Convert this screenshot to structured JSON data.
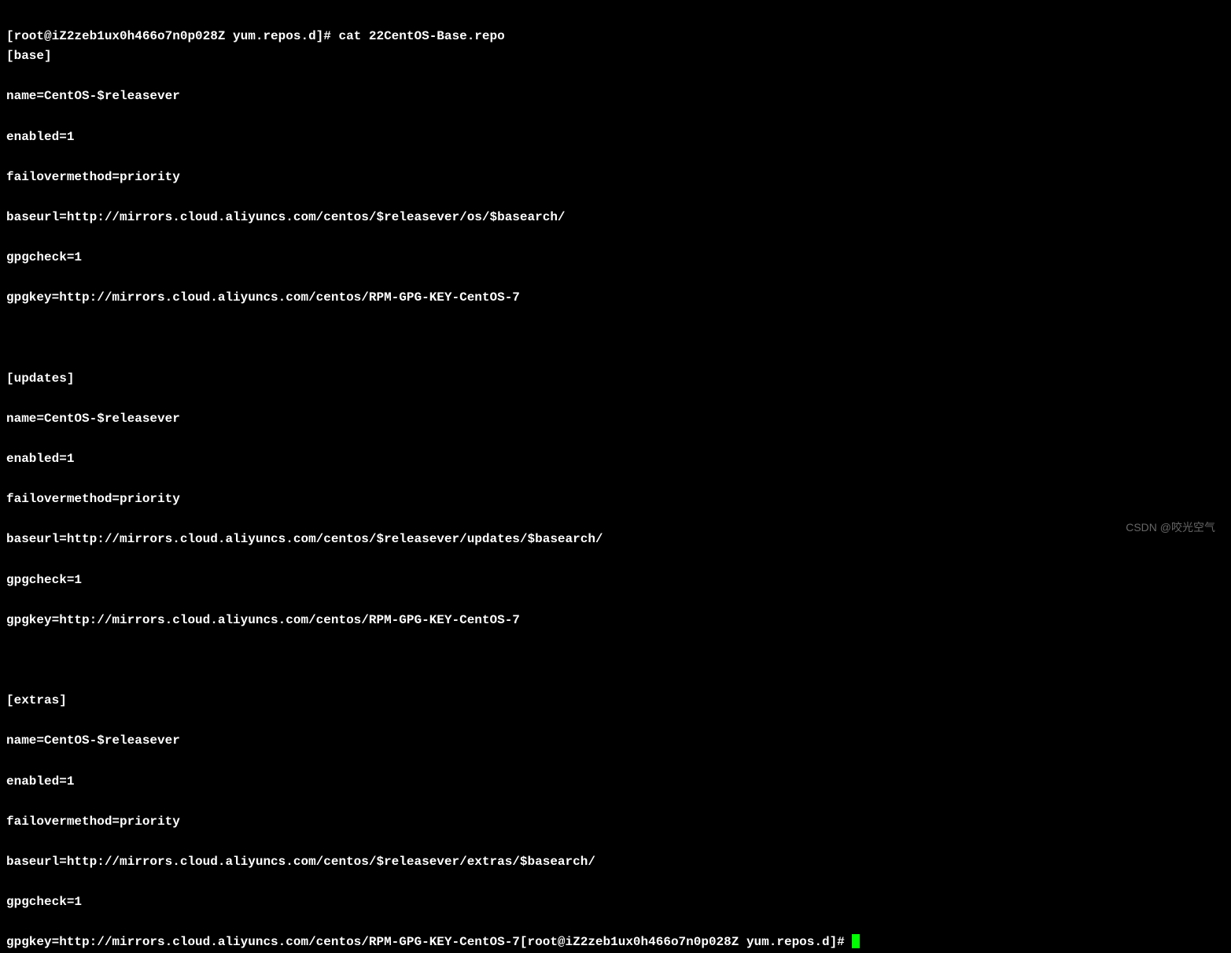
{
  "prompt1": "[root@iZ2zeb1ux0h466o7n0p028Z yum.repos.d]# ",
  "command1": "cat 22CentOS-Base.repo",
  "output": {
    "base": {
      "header": "[base]",
      "name": "name=CentOS-$releasever",
      "enabled": "enabled=1",
      "failovermethod": "failovermethod=priority",
      "baseurl": "baseurl=http://mirrors.cloud.aliyuncs.com/centos/$releasever/os/$basearch/",
      "gpgcheck": "gpgcheck=1",
      "gpgkey": "gpgkey=http://mirrors.cloud.aliyuncs.com/centos/RPM-GPG-KEY-CentOS-7"
    },
    "updates": {
      "header": "[updates]",
      "name": "name=CentOS-$releasever",
      "enabled": "enabled=1",
      "failovermethod": "failovermethod=priority",
      "baseurl": "baseurl=http://mirrors.cloud.aliyuncs.com/centos/$releasever/updates/$basearch/",
      "gpgcheck": "gpgcheck=1",
      "gpgkey": "gpgkey=http://mirrors.cloud.aliyuncs.com/centos/RPM-GPG-KEY-CentOS-7"
    },
    "extras": {
      "header": "[extras]",
      "name": "name=CentOS-$releasever",
      "enabled": "enabled=1",
      "failovermethod": "failovermethod=priority",
      "baseurl": "baseurl=http://mirrors.cloud.aliyuncs.com/centos/$releasever/extras/$basearch/",
      "gpgcheck": "gpgcheck=1",
      "gpgkey": "gpgkey=http://mirrors.cloud.aliyuncs.com/centos/RPM-GPG-KEY-CentOS-7"
    }
  },
  "prompt2": "[root@iZ2zeb1ux0h466o7n0p028Z yum.repos.d]# ",
  "watermark": "CSDN @咬光空气"
}
